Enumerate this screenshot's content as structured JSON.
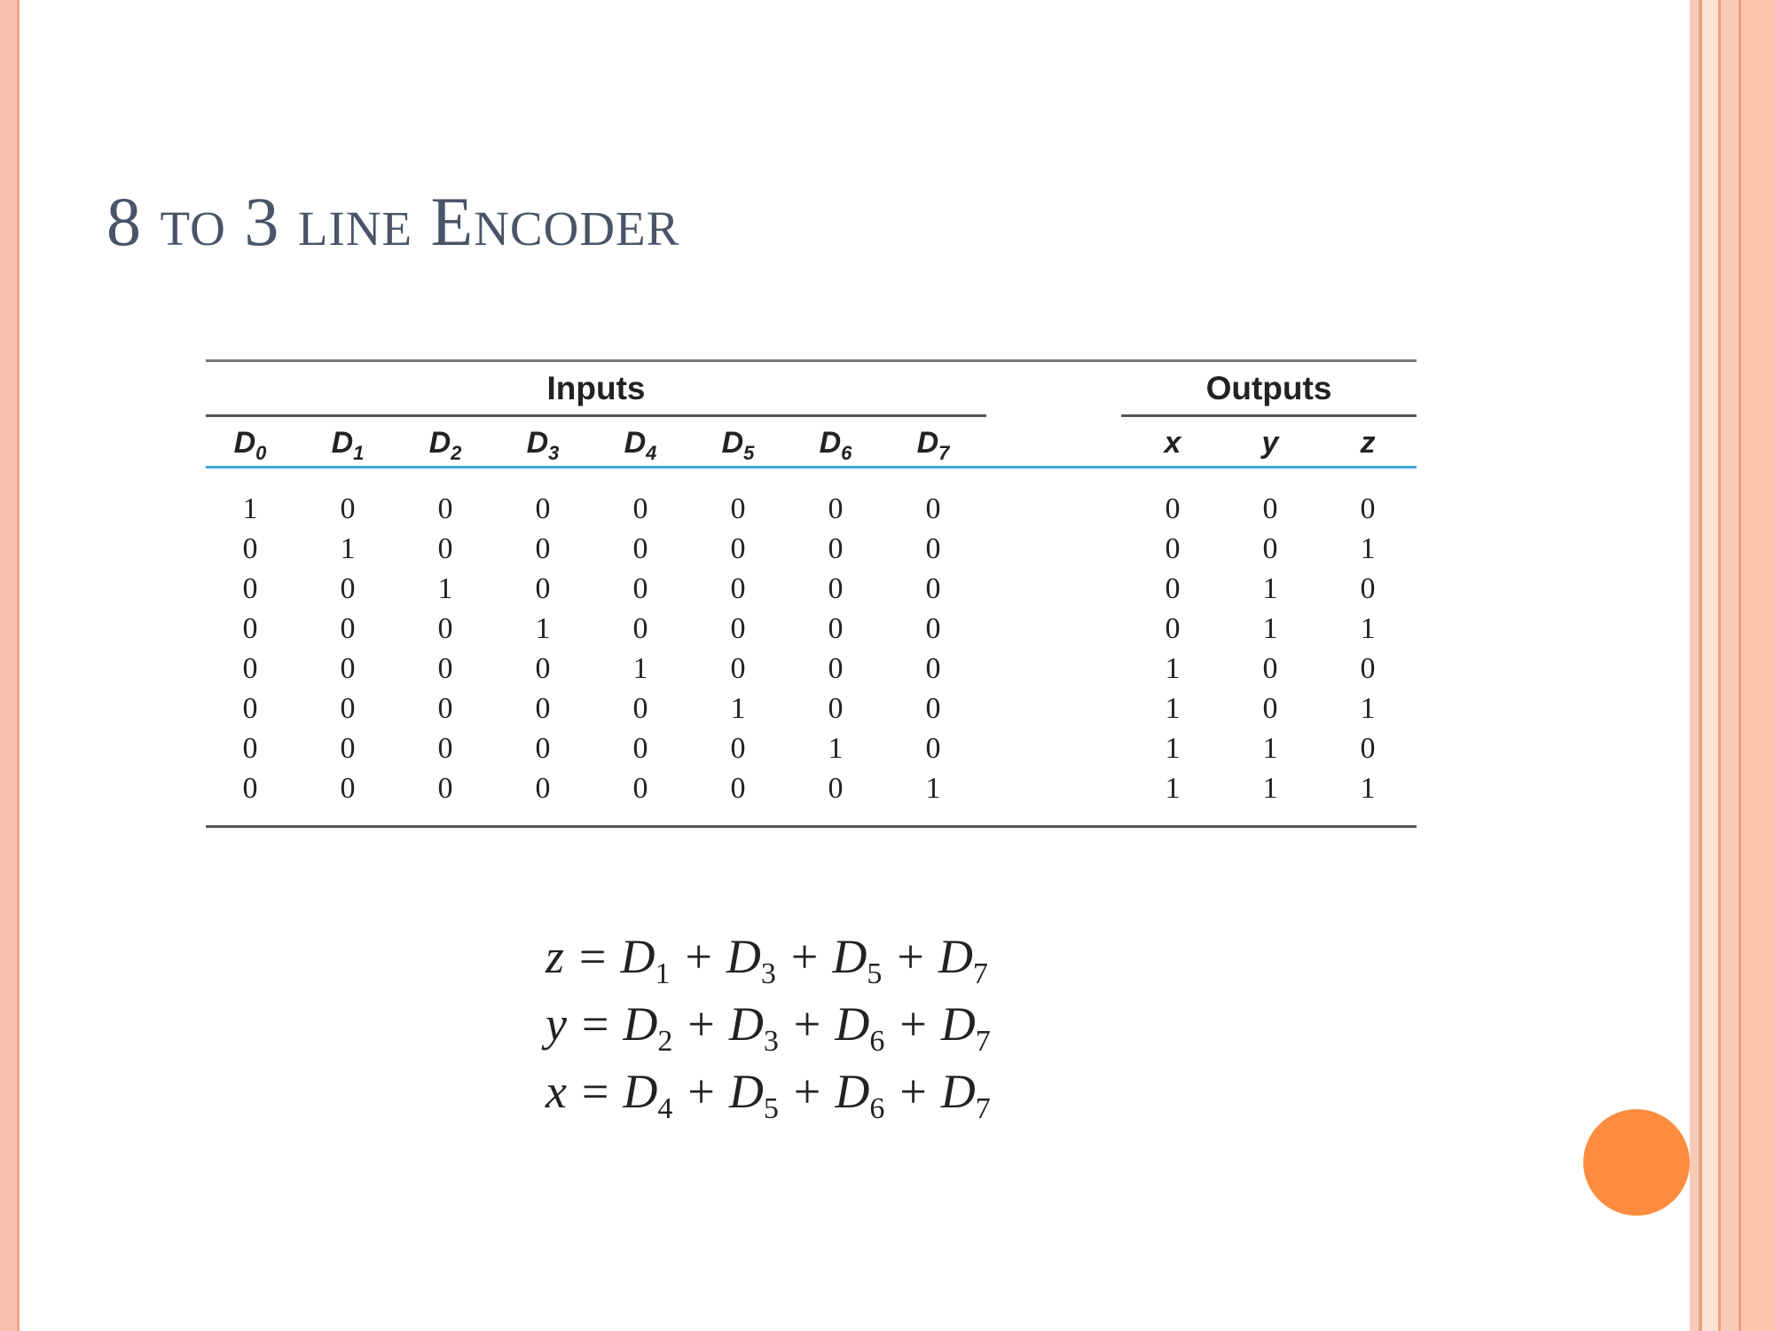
{
  "slide": {
    "title": "8 to 3 line Encoder",
    "accent_color": "#fd8c3e",
    "frame_color": "#f6c2ad"
  },
  "truth_table": {
    "inputs_label": "Inputs",
    "outputs_label": "Outputs",
    "input_columns": [
      {
        "base": "D",
        "sub": "0"
      },
      {
        "base": "D",
        "sub": "1"
      },
      {
        "base": "D",
        "sub": "2"
      },
      {
        "base": "D",
        "sub": "3"
      },
      {
        "base": "D",
        "sub": "4"
      },
      {
        "base": "D",
        "sub": "5"
      },
      {
        "base": "D",
        "sub": "6"
      },
      {
        "base": "D",
        "sub": "7"
      }
    ],
    "output_columns": [
      "x",
      "y",
      "z"
    ],
    "rows": [
      {
        "inputs": [
          "1",
          "0",
          "0",
          "0",
          "0",
          "0",
          "0",
          "0"
        ],
        "outputs": [
          "0",
          "0",
          "0"
        ]
      },
      {
        "inputs": [
          "0",
          "1",
          "0",
          "0",
          "0",
          "0",
          "0",
          "0"
        ],
        "outputs": [
          "0",
          "0",
          "1"
        ]
      },
      {
        "inputs": [
          "0",
          "0",
          "1",
          "0",
          "0",
          "0",
          "0",
          "0"
        ],
        "outputs": [
          "0",
          "1",
          "0"
        ]
      },
      {
        "inputs": [
          "0",
          "0",
          "0",
          "1",
          "0",
          "0",
          "0",
          "0"
        ],
        "outputs": [
          "0",
          "1",
          "1"
        ]
      },
      {
        "inputs": [
          "0",
          "0",
          "0",
          "0",
          "1",
          "0",
          "0",
          "0"
        ],
        "outputs": [
          "1",
          "0",
          "0"
        ]
      },
      {
        "inputs": [
          "0",
          "0",
          "0",
          "0",
          "0",
          "1",
          "0",
          "0"
        ],
        "outputs": [
          "1",
          "0",
          "1"
        ]
      },
      {
        "inputs": [
          "0",
          "0",
          "0",
          "0",
          "0",
          "0",
          "1",
          "0"
        ],
        "outputs": [
          "1",
          "1",
          "0"
        ]
      },
      {
        "inputs": [
          "0",
          "0",
          "0",
          "0",
          "0",
          "0",
          "0",
          "1"
        ],
        "outputs": [
          "1",
          "1",
          "1"
        ]
      }
    ]
  },
  "equations": [
    {
      "lhs": "z",
      "terms": [
        {
          "base": "D",
          "sub": "1"
        },
        {
          "base": "D",
          "sub": "3"
        },
        {
          "base": "D",
          "sub": "5"
        },
        {
          "base": "D",
          "sub": "7"
        }
      ]
    },
    {
      "lhs": "y",
      "terms": [
        {
          "base": "D",
          "sub": "2"
        },
        {
          "base": "D",
          "sub": "3"
        },
        {
          "base": "D",
          "sub": "6"
        },
        {
          "base": "D",
          "sub": "7"
        }
      ]
    },
    {
      "lhs": "x",
      "terms": [
        {
          "base": "D",
          "sub": "4"
        },
        {
          "base": "D",
          "sub": "5"
        },
        {
          "base": "D",
          "sub": "6"
        },
        {
          "base": "D",
          "sub": "7"
        }
      ]
    }
  ]
}
